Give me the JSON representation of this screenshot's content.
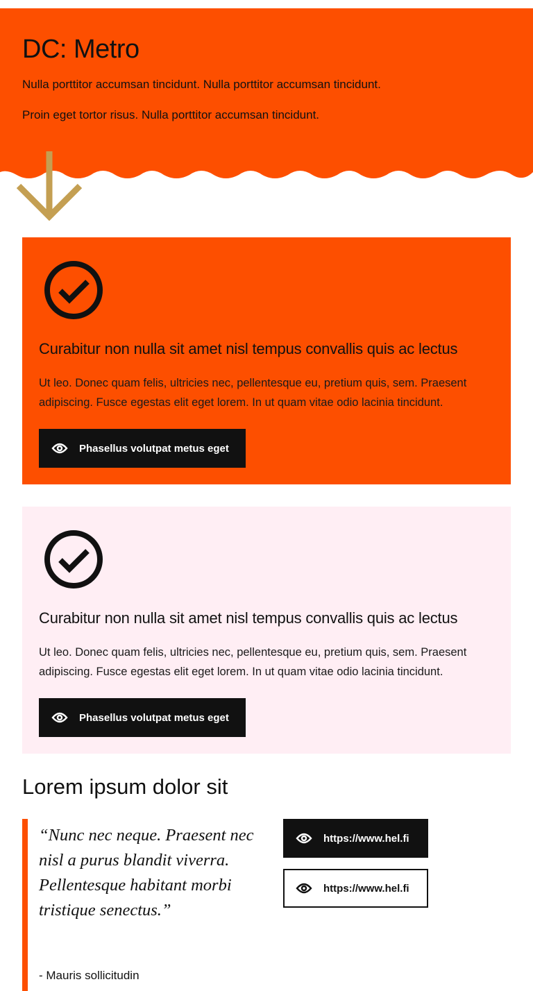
{
  "hero": {
    "title": "DC: Metro",
    "paragraphs": [
      "Nulla porttitor accumsan tincidunt. Nulla porttitor accumsan tincidunt.",
      "Proin eget tortor risus. Nulla porttitor accumsan tincidunt."
    ]
  },
  "cards": [
    {
      "heading": "Curabitur non nulla sit amet nisl tempus convallis quis ac lectus",
      "text": "Ut leo. Donec quam felis, ultricies nec, pellentesque eu, pretium quis, sem. Praesent adipiscing. Fusce egestas elit eget lorem. In ut quam vitae odio lacinia tincidunt.",
      "button_label": "Phasellus volutpat metus eget"
    },
    {
      "heading": "Curabitur non nulla sit amet nisl tempus convallis quis ac lectus",
      "text": "Ut leo. Donec quam felis, ultricies nec, pellentesque eu, pretium quis, sem. Praesent adipiscing. Fusce egestas elit eget lorem. In ut quam vitae odio lacinia tincidunt.",
      "button_label": "Phasellus volutpat metus eget"
    }
  ],
  "section": {
    "title": "Lorem ipsum dolor sit",
    "quote": "“Nunc nec neque. Praesent nec nisl a purus blandit viverra. Pellentesque habitant morbi tristique senectus.”",
    "author": "- Mauris sollicitudin",
    "links": [
      "https://www.hel.fi",
      "https://www.hel.fi"
    ]
  },
  "icons": {
    "hero_arrow": "arrow-down-icon",
    "card_icon": "check-circle-icon",
    "button_icon": "eye-icon"
  },
  "colors": {
    "brand_orange": "#fd4f00",
    "pink_background": "#ffeef4",
    "arrow_gold": "#c49f52",
    "button_dark": "#111111"
  }
}
